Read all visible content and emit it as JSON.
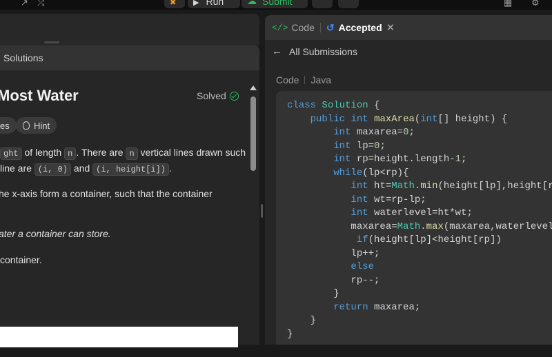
{
  "topbar": {
    "run_label": "Run",
    "submit_label": "Submit"
  },
  "description": {
    "tab_label": "Solutions",
    "title": "Most Water",
    "status": "Solved",
    "chips": [
      "es",
      "Hint"
    ],
    "p1_a": "ght",
    "p1_b": " of length ",
    "p1_c": "n",
    "p1_d": ". There are ",
    "p1_e": "n",
    "p1_f": " vertical lines drawn such",
    "p2_a": " line are ",
    "p2_b": "(i, 0)",
    "p2_c": " and ",
    "p2_d": "(i, height[i])",
    "p2_e": ".",
    "p3": "he x-axis form a container, such that the container",
    "p4": "ater a container can store.",
    "p5": " container."
  },
  "submission": {
    "tab_code": "Code",
    "tab_accepted": "Accepted",
    "back_label": "All Submissions",
    "section_code": "Code",
    "language": "Java"
  },
  "code": [
    "class Solution {",
    "    public int maxArea(int[] height) {",
    "        int maxarea=0;",
    "        int lp=0;",
    "        int rp=height.length-1;",
    "        while(lp<rp){",
    "           int ht=Math.min(height[lp],height[rp]);",
    "           int wt=rp-lp;",
    "           int waterlevel=ht*wt;",
    "           maxarea=Math.max(maxarea,waterlevel);",
    "            if(height[lp]<height[rp])",
    "           lp++;",
    "           else",
    "           rp--;",
    "        }",
    "        return maxarea;",
    "    }",
    "}"
  ]
}
